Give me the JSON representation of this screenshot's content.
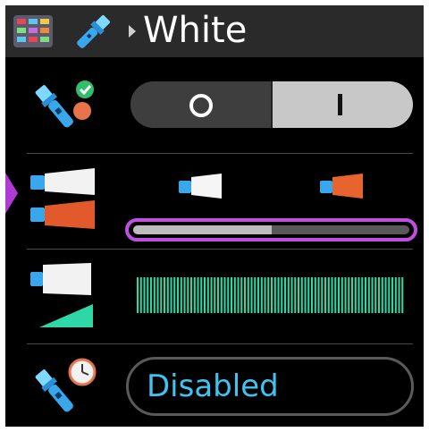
{
  "header": {
    "title": "White",
    "app_icon": "film-app-icon",
    "mode_icon": "flashlight-icon",
    "separator_icon": "chevron-right-icon"
  },
  "rows": {
    "power": {
      "icon": "flashlight-toggle-icon",
      "off_symbol": "power-off-icon",
      "on_symbol": "power-on-icon",
      "state": "on"
    },
    "color": {
      "icon": "flashlight-color-icon",
      "left_icon": "flashlight-white-icon",
      "right_icon": "flashlight-red-icon",
      "balance": 0.5
    },
    "brightness": {
      "icon": "flashlight-brightness-icon",
      "level": 1.0,
      "accent": "#2fd6a6"
    },
    "timer": {
      "icon": "flashlight-timer-icon",
      "value": "Disabled"
    }
  },
  "colors": {
    "selection": "#b13ad6",
    "value_text": "#3fc4f2"
  }
}
